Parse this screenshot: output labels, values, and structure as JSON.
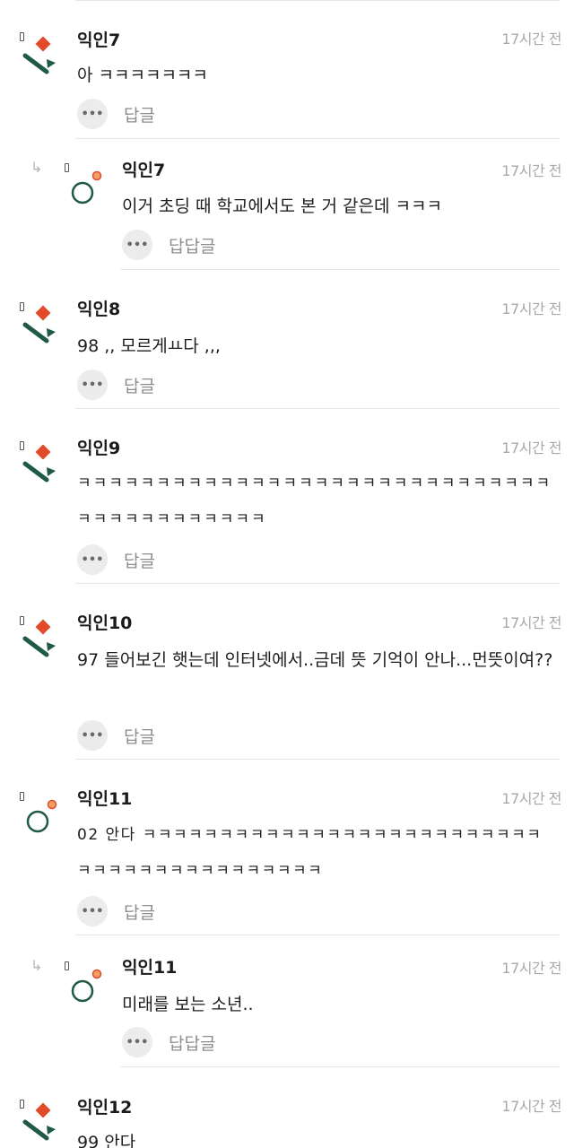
{
  "comments": [
    {
      "name": "익인7",
      "time": "17시간 전",
      "text": "아 ㅋㅋㅋㅋㅋㅋㅋ",
      "reply_label": "답글",
      "avatar": "green-red-icon"
    },
    {
      "name": "익인7",
      "time": "17시간 전",
      "text": "이거 초딩 때 학교에서도 본 거 같은데 ㅋㅋㅋ",
      "reply_label": "답답글",
      "avatar": "circle-icon"
    },
    {
      "name": "익인8",
      "time": "17시간 전",
      "text": "98 ,, 모르게ㅛ다 ,,,",
      "reply_label": "답글",
      "avatar": "green-red-icon"
    },
    {
      "name": "익인9",
      "time": "17시간 전",
      "text": "ㅋㅋㅋㅋㅋㅋㅋㅋㅋㅋㅋㅋㅋㅋㅋㅋㅋㅋㅋㅋㅋㅋㅋㅋㅋㅋㅋㅋㅋㅋㅋㅋㅋㅋㅋㅋㅋㅋㅋㅋㅋㅋ",
      "reply_label": "답글",
      "avatar": "green-red-icon"
    },
    {
      "name": "익인10",
      "time": "17시간 전",
      "text": "97 들어보긴 햇는데 인터넷에서..금데 뜻 기억이 안나...먼뜻이여??",
      "reply_label": "답글",
      "avatar": "green-red-icon"
    },
    {
      "name": "익인11",
      "time": "17시간 전",
      "text": "02 안다 ㅋㅋㅋㅋㅋㅋㅋㅋㅋㅋㅋㅋㅋㅋㅋㅋㅋㅋㅋㅋㅋㅋㅋㅋㅋㅋㅋㅋㅋㅋㅋㅋㅋㅋㅋㅋㅋㅋㅋㅋㅋㅋ",
      "reply_label": "답글",
      "avatar": "circle-icon"
    },
    {
      "name": "익인11",
      "time": "17시간 전",
      "text": "미래를 보는 소년..",
      "reply_label": "답답글",
      "avatar": "circle-icon"
    },
    {
      "name": "익인12",
      "time": "17시간 전",
      "text": "99 안다",
      "reply_label": "",
      "avatar": "green-red-icon"
    }
  ],
  "colors": {
    "green": "#1f5a44",
    "red": "#e34a2a",
    "orange": "#f0a060",
    "divider": "#e6e6e6"
  },
  "icons": {
    "reply_arrow": "reply-arrow-icon",
    "more": "more-dots-icon"
  }
}
